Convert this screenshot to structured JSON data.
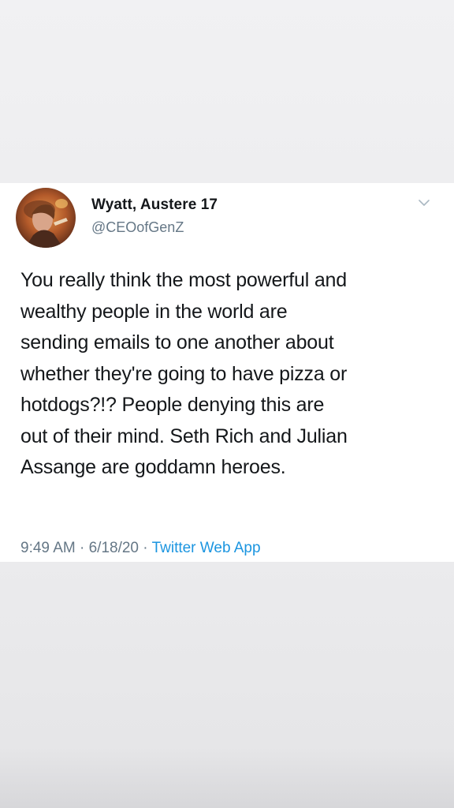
{
  "tweet": {
    "author": {
      "display_name": "Wyatt, Austere 17",
      "handle": "@CEOofGenZ",
      "avatar_icon": "profile-avatar"
    },
    "menu_icon": "chevron-down-icon",
    "text": "You really think the most powerful and\nwealthy people in the world are\nsending emails to one another about\nwhether they're going to have pizza or\nhotdogs?!? People denying this are\nout of their mind. Seth Rich and Julian\nAssange are goddamn heroes.",
    "time": "9:49 AM",
    "separator": " · ",
    "date": "6/18/20",
    "source": "Twitter Web App"
  },
  "colors": {
    "text": "#14171a",
    "secondary": "#657786",
    "link": "#1b95e0",
    "card_background": "#ffffff",
    "page_background": "#efeff1"
  }
}
